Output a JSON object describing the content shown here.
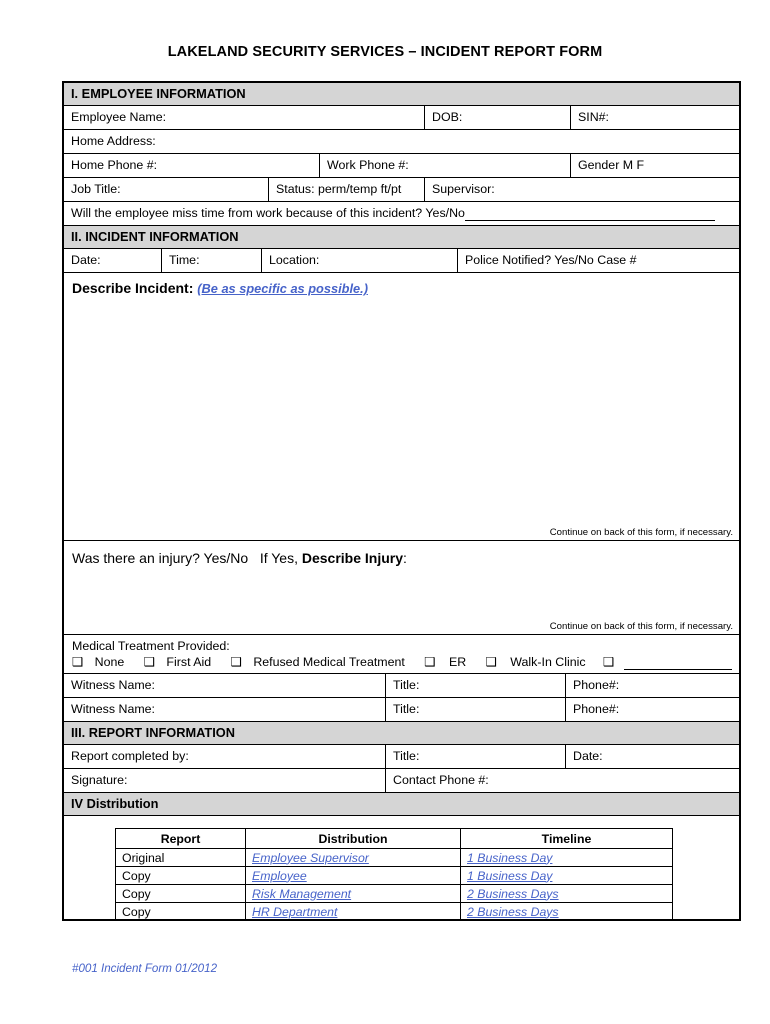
{
  "document": {
    "title": "LAKELAND SECURITY SERVICES – INCIDENT REPORT FORM",
    "footer": "#001 Incident Form   01/2012",
    "accent_color": "#4763c9",
    "header_fill": "#d5d5d5"
  },
  "section_employee": {
    "heading": "I.  EMPLOYEE INFORMATION",
    "employee_name_label": "Employee Name:",
    "dob_label": "DOB:",
    "sin_label": "SIN#:",
    "home_address_label": "Home Address:",
    "home_phone_label": "Home Phone #:",
    "work_phone_label": "Work Phone #:",
    "gender_label": "Gender   M   F",
    "job_title_label": "Job Title:",
    "status_label": "Status: perm/temp   ft/pt",
    "supervisor_label": "Supervisor:",
    "miss_time_label": "Will the employee miss time from work because of this incident?  Yes/No"
  },
  "section_incident": {
    "heading": "II. INCIDENT INFORMATION",
    "date_label": "Date:",
    "time_label": "Time:",
    "location_label": "Location:",
    "police_label": "Police Notified? Yes/No Case #",
    "describe_label": "Describe Incident",
    "describe_colon": ":",
    "describe_hint": "(Be as specific as possible.)",
    "continue_note": "Continue on back of this form, if necessary.",
    "injury_question": "Was there an injury?  Yes/No",
    "injury_if_yes": "If Yes,",
    "injury_describe_label": "Describe Injury",
    "injury_colon": ":",
    "injury_continue_note": "Continue on back of this form, if necessary.",
    "medical_heading": "Medical Treatment Provided:",
    "medical_options": [
      "None",
      "First Aid",
      "Refused Medical Treatment",
      "ER",
      "Walk-In Clinic",
      ""
    ],
    "checkbox_glyph": "❑",
    "witness1_name_label": "Witness Name:",
    "witness1_title_label": "Title:",
    "witness1_phone_label": "Phone#:",
    "witness2_name_label": "Witness Name:",
    "witness2_title_label": "Title:",
    "witness2_phone_label": "Phone#:"
  },
  "section_report": {
    "heading": "III. REPORT INFORMATION",
    "completed_by_label": "Report completed by:",
    "title_label": "Title:",
    "date_label": "Date:",
    "signature_label": "Signature:",
    "contact_phone_label": "Contact Phone #:"
  },
  "section_distribution": {
    "heading": "IV Distribution",
    "columns": [
      "Report",
      "Distribution",
      "Timeline"
    ],
    "rows": [
      {
        "report": "Original",
        "distribution": "Employee Supervisor",
        "timeline": "1 Business Day"
      },
      {
        "report": "Copy",
        "distribution": "Employee",
        "timeline": "1 Business Day"
      },
      {
        "report": "Copy",
        "distribution": "Risk Management",
        "timeline": "2 Business Days"
      },
      {
        "report": "Copy",
        "distribution": "HR Department",
        "timeline": "2 Business Days"
      }
    ]
  }
}
